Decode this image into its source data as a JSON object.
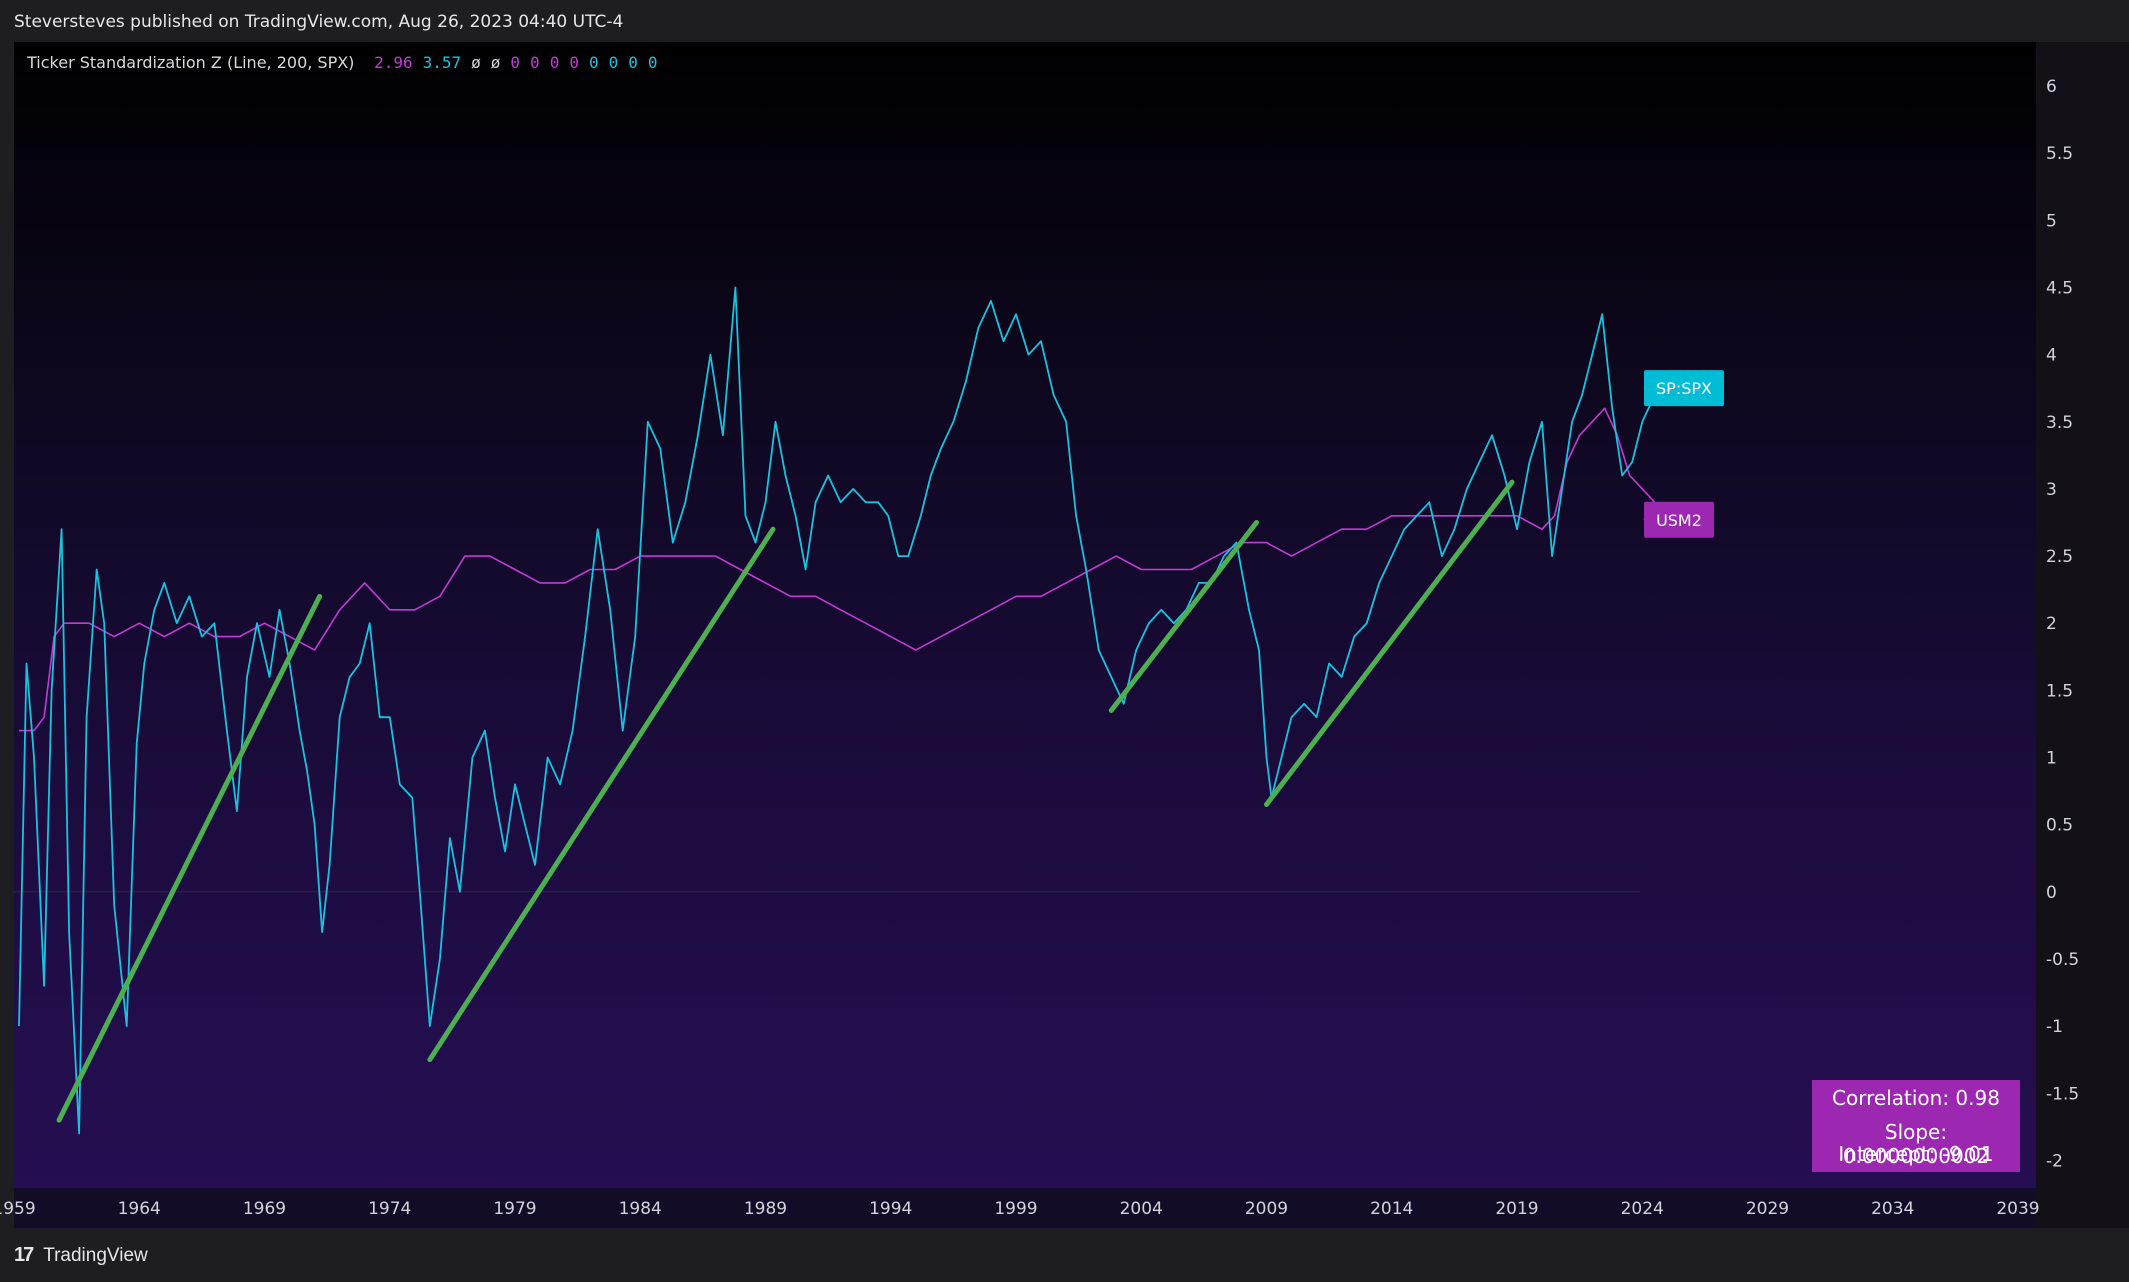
{
  "header": {
    "text": "Steversteves published on TradingView.com, Aug 26, 2023 04:40 UTC-4"
  },
  "legend": {
    "title": "Ticker Standardization Z (Line, 200, SPX)",
    "values": [
      {
        "text": "2.96",
        "color": "#c23bd4"
      },
      {
        "text": "3.57",
        "color": "#17c3e0"
      },
      {
        "text": "ø",
        "color": "#d8d8d8"
      },
      {
        "text": "ø",
        "color": "#d8d8d8"
      },
      {
        "text": "0",
        "color": "#c23bd4"
      },
      {
        "text": "0",
        "color": "#c23bd4"
      },
      {
        "text": "0",
        "color": "#c23bd4"
      },
      {
        "text": "0",
        "color": "#c23bd4"
      },
      {
        "text": "0",
        "color": "#17c3e0"
      },
      {
        "text": "0",
        "color": "#17c3e0"
      },
      {
        "text": "0",
        "color": "#17c3e0"
      },
      {
        "text": "0",
        "color": "#17c3e0"
      }
    ]
  },
  "stats": {
    "correlation": "Correlation: 0.98",
    "slope": "Slope: 0.0000000002",
    "intercept": "Intercept: -9.01"
  },
  "footer": {
    "brand": "TradingView",
    "logo": "17"
  },
  "colors": {
    "spx": "#17c3e0",
    "usm2": "#c23bd4",
    "trend": "#4caf50",
    "spx_label_bg": "#00bcd4",
    "usm2_label_bg": "#9c27b0",
    "stats_bg": "#9c27b0"
  },
  "chart_data": {
    "type": "line",
    "title": "",
    "xlabel": "",
    "ylabel": "",
    "xlim": [
      1959,
      2039
    ],
    "ylim": [
      -2.1,
      6.3
    ],
    "x_ticks": [
      "1959",
      "1964",
      "1969",
      "1974",
      "1979",
      "1984",
      "1989",
      "1994",
      "1999",
      "2004",
      "2009",
      "2014",
      "2019",
      "2024",
      "2029",
      "2034",
      "2039"
    ],
    "y_ticks": [
      "6",
      "5.5",
      "5",
      "4.5",
      "4",
      "3.5",
      "3",
      "2.5",
      "2",
      "1.5",
      "1",
      "0.5",
      "0",
      "-0.5",
      "-1",
      "-1.5",
      "-2"
    ],
    "grid": false,
    "series": [
      {
        "name": "SP:SPX",
        "color": "#17c3e0",
        "points": [
          [
            1959.2,
            -1.0
          ],
          [
            1959.5,
            1.7
          ],
          [
            1959.8,
            1.0
          ],
          [
            1960.2,
            -0.7
          ],
          [
            1960.5,
            1.5
          ],
          [
            1960.9,
            2.7
          ],
          [
            1961.2,
            -0.3
          ],
          [
            1961.6,
            -1.8
          ],
          [
            1961.9,
            1.3
          ],
          [
            1962.3,
            2.4
          ],
          [
            1962.6,
            2.0
          ],
          [
            1963.0,
            -0.1
          ],
          [
            1963.5,
            -1.0
          ],
          [
            1963.9,
            1.1
          ],
          [
            1964.2,
            1.7
          ],
          [
            1964.6,
            2.1
          ],
          [
            1965.0,
            2.3
          ],
          [
            1965.5,
            2.0
          ],
          [
            1966.0,
            2.2
          ],
          [
            1966.5,
            1.9
          ],
          [
            1967.0,
            2.0
          ],
          [
            1967.5,
            1.2
          ],
          [
            1967.9,
            0.6
          ],
          [
            1968.3,
            1.6
          ],
          [
            1968.7,
            2.0
          ],
          [
            1969.2,
            1.6
          ],
          [
            1969.6,
            2.1
          ],
          [
            1970.0,
            1.7
          ],
          [
            1970.4,
            1.2
          ],
          [
            1970.7,
            0.9
          ],
          [
            1971.0,
            0.5
          ],
          [
            1971.3,
            -0.3
          ],
          [
            1971.6,
            0.2
          ],
          [
            1972.0,
            1.3
          ],
          [
            1972.4,
            1.6
          ],
          [
            1972.8,
            1.7
          ],
          [
            1973.2,
            2.0
          ],
          [
            1973.6,
            1.3
          ],
          [
            1974.0,
            1.3
          ],
          [
            1974.4,
            0.8
          ],
          [
            1974.9,
            0.7
          ],
          [
            1975.2,
            0.0
          ],
          [
            1975.6,
            -1.0
          ],
          [
            1976.0,
            -0.5
          ],
          [
            1976.4,
            0.4
          ],
          [
            1976.8,
            0.0
          ],
          [
            1977.3,
            1.0
          ],
          [
            1977.8,
            1.2
          ],
          [
            1978.2,
            0.7
          ],
          [
            1978.6,
            0.3
          ],
          [
            1979.0,
            0.8
          ],
          [
            1979.4,
            0.5
          ],
          [
            1979.8,
            0.2
          ],
          [
            1980.3,
            1.0
          ],
          [
            1980.8,
            0.8
          ],
          [
            1981.3,
            1.2
          ],
          [
            1981.8,
            1.9
          ],
          [
            1982.3,
            2.7
          ],
          [
            1982.8,
            2.1
          ],
          [
            1983.3,
            1.2
          ],
          [
            1983.8,
            1.9
          ],
          [
            1984.3,
            3.5
          ],
          [
            1984.8,
            3.3
          ],
          [
            1985.3,
            2.6
          ],
          [
            1985.8,
            2.9
          ],
          [
            1986.3,
            3.4
          ],
          [
            1986.8,
            4.0
          ],
          [
            1987.3,
            3.4
          ],
          [
            1987.8,
            4.5
          ],
          [
            1988.2,
            2.8
          ],
          [
            1988.6,
            2.6
          ],
          [
            1989.0,
            2.9
          ],
          [
            1989.4,
            3.5
          ],
          [
            1989.8,
            3.1
          ],
          [
            1990.2,
            2.8
          ],
          [
            1990.6,
            2.4
          ],
          [
            1991.0,
            2.9
          ],
          [
            1991.5,
            3.1
          ],
          [
            1992.0,
            2.9
          ],
          [
            1992.5,
            3.0
          ],
          [
            1993.0,
            2.9
          ],
          [
            1993.5,
            2.9
          ],
          [
            1993.9,
            2.8
          ],
          [
            1994.3,
            2.5
          ],
          [
            1994.7,
            2.5
          ],
          [
            1995.2,
            2.8
          ],
          [
            1995.6,
            3.1
          ],
          [
            1996.0,
            3.3
          ],
          [
            1996.5,
            3.5
          ],
          [
            1997.0,
            3.8
          ],
          [
            1997.5,
            4.2
          ],
          [
            1998.0,
            4.4
          ],
          [
            1998.5,
            4.1
          ],
          [
            1999.0,
            4.3
          ],
          [
            1999.5,
            4.0
          ],
          [
            2000.0,
            4.1
          ],
          [
            2000.5,
            3.7
          ],
          [
            2001.0,
            3.5
          ],
          [
            2001.4,
            2.8
          ],
          [
            2001.8,
            2.4
          ],
          [
            2002.3,
            1.8
          ],
          [
            2002.8,
            1.6
          ],
          [
            2003.3,
            1.4
          ],
          [
            2003.8,
            1.8
          ],
          [
            2004.3,
            2.0
          ],
          [
            2004.8,
            2.1
          ],
          [
            2005.3,
            2.0
          ],
          [
            2005.8,
            2.1
          ],
          [
            2006.3,
            2.3
          ],
          [
            2006.8,
            2.3
          ],
          [
            2007.3,
            2.5
          ],
          [
            2007.8,
            2.6
          ],
          [
            2008.3,
            2.1
          ],
          [
            2008.7,
            1.8
          ],
          [
            2009.0,
            1.0
          ],
          [
            2009.2,
            0.7
          ],
          [
            2009.6,
            1.0
          ],
          [
            2010.0,
            1.3
          ],
          [
            2010.5,
            1.4
          ],
          [
            2011.0,
            1.3
          ],
          [
            2011.5,
            1.7
          ],
          [
            2012.0,
            1.6
          ],
          [
            2012.5,
            1.9
          ],
          [
            2013.0,
            2.0
          ],
          [
            2013.5,
            2.3
          ],
          [
            2014.0,
            2.5
          ],
          [
            2014.5,
            2.7
          ],
          [
            2015.0,
            2.8
          ],
          [
            2015.5,
            2.9
          ],
          [
            2016.0,
            2.5
          ],
          [
            2016.5,
            2.7
          ],
          [
            2017.0,
            3.0
          ],
          [
            2017.5,
            3.2
          ],
          [
            2018.0,
            3.4
          ],
          [
            2018.5,
            3.1
          ],
          [
            2019.0,
            2.7
          ],
          [
            2019.5,
            3.2
          ],
          [
            2020.0,
            3.5
          ],
          [
            2020.4,
            2.5
          ],
          [
            2020.8,
            3.0
          ],
          [
            2021.2,
            3.5
          ],
          [
            2021.6,
            3.7
          ],
          [
            2022.0,
            4.0
          ],
          [
            2022.4,
            4.3
          ],
          [
            2022.8,
            3.6
          ],
          [
            2023.2,
            3.1
          ],
          [
            2023.6,
            3.2
          ],
          [
            2024.0,
            3.5
          ],
          [
            2024.5,
            3.7
          ]
        ]
      },
      {
        "name": "USM2",
        "color": "#c23bd4",
        "points": [
          [
            1959.2,
            1.2
          ],
          [
            1959.8,
            1.2
          ],
          [
            1960.2,
            1.3
          ],
          [
            1960.6,
            1.9
          ],
          [
            1961.0,
            2.0
          ],
          [
            1962.0,
            2.0
          ],
          [
            1963.0,
            1.9
          ],
          [
            1964.0,
            2.0
          ],
          [
            1965.0,
            1.9
          ],
          [
            1966.0,
            2.0
          ],
          [
            1967.0,
            1.9
          ],
          [
            1968.0,
            1.9
          ],
          [
            1969.0,
            2.0
          ],
          [
            1970.0,
            1.9
          ],
          [
            1971.0,
            1.8
          ],
          [
            1972.0,
            2.1
          ],
          [
            1973.0,
            2.3
          ],
          [
            1974.0,
            2.1
          ],
          [
            1975.0,
            2.1
          ],
          [
            1976.0,
            2.2
          ],
          [
            1977.0,
            2.5
          ],
          [
            1978.0,
            2.5
          ],
          [
            1979.0,
            2.4
          ],
          [
            1980.0,
            2.3
          ],
          [
            1981.0,
            2.3
          ],
          [
            1982.0,
            2.4
          ],
          [
            1983.0,
            2.4
          ],
          [
            1984.0,
            2.5
          ],
          [
            1985.0,
            2.5
          ],
          [
            1986.0,
            2.5
          ],
          [
            1987.0,
            2.5
          ],
          [
            1988.0,
            2.4
          ],
          [
            1989.0,
            2.3
          ],
          [
            1990.0,
            2.2
          ],
          [
            1991.0,
            2.2
          ],
          [
            1992.0,
            2.1
          ],
          [
            1993.0,
            2.0
          ],
          [
            1994.0,
            1.9
          ],
          [
            1995.0,
            1.8
          ],
          [
            1996.0,
            1.9
          ],
          [
            1997.0,
            2.0
          ],
          [
            1998.0,
            2.1
          ],
          [
            1999.0,
            2.2
          ],
          [
            2000.0,
            2.2
          ],
          [
            2001.0,
            2.3
          ],
          [
            2002.0,
            2.4
          ],
          [
            2003.0,
            2.5
          ],
          [
            2004.0,
            2.4
          ],
          [
            2005.0,
            2.4
          ],
          [
            2006.0,
            2.4
          ],
          [
            2007.0,
            2.5
          ],
          [
            2008.0,
            2.6
          ],
          [
            2009.0,
            2.6
          ],
          [
            2010.0,
            2.5
          ],
          [
            2011.0,
            2.6
          ],
          [
            2012.0,
            2.7
          ],
          [
            2013.0,
            2.7
          ],
          [
            2014.0,
            2.8
          ],
          [
            2015.0,
            2.8
          ],
          [
            2016.0,
            2.8
          ],
          [
            2017.0,
            2.8
          ],
          [
            2018.0,
            2.8
          ],
          [
            2019.0,
            2.8
          ],
          [
            2020.0,
            2.7
          ],
          [
            2020.5,
            2.8
          ],
          [
            2021.0,
            3.2
          ],
          [
            2021.5,
            3.4
          ],
          [
            2022.0,
            3.5
          ],
          [
            2022.5,
            3.6
          ],
          [
            2023.0,
            3.4
          ],
          [
            2023.5,
            3.1
          ],
          [
            2024.0,
            3.0
          ],
          [
            2024.5,
            2.9
          ]
        ]
      }
    ],
    "trendlines": [
      {
        "from": [
          1960.8,
          -1.7
        ],
        "to": [
          1971.2,
          2.2
        ]
      },
      {
        "from": [
          1975.6,
          -1.25
        ],
        "to": [
          1989.3,
          2.7
        ]
      },
      {
        "from": [
          2002.8,
          1.35
        ],
        "to": [
          2008.6,
          2.75
        ]
      },
      {
        "from": [
          2009.0,
          0.65
        ],
        "to": [
          2018.8,
          3.05
        ]
      }
    ],
    "end_labels": [
      {
        "text": "SP:SPX",
        "value": 3.75
      },
      {
        "text": "USM2",
        "value": 2.77
      }
    ]
  }
}
